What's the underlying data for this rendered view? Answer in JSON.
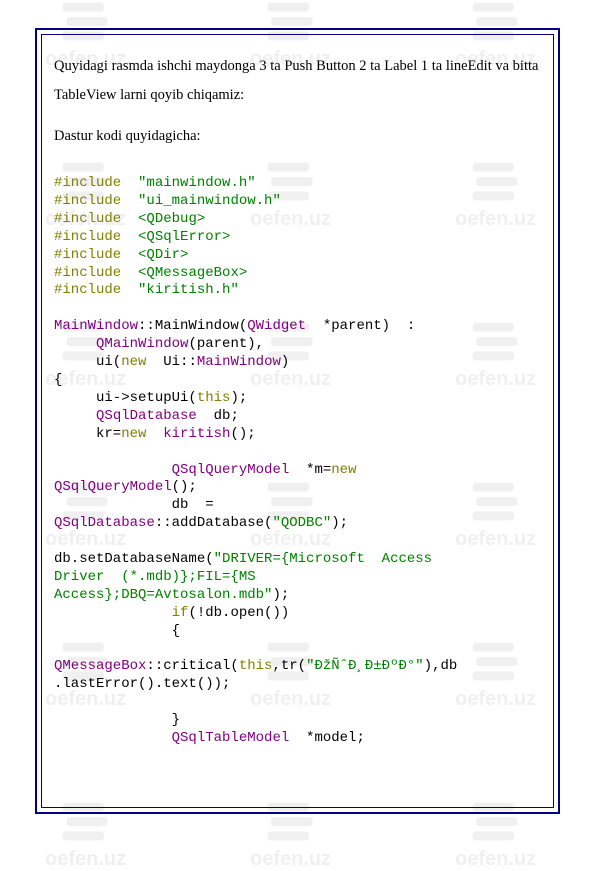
{
  "watermark_text": "oefen.uz",
  "paragraphs": {
    "p1": "Quyidagi rasmda ishchi maydonga 3 ta Push Button 2 ta Label 1 ta lineEdit va bitta TableView larni qoyib chiqamiz:",
    "p2": "Dastur kodi quyidagicha:"
  },
  "code": {
    "tokens": [
      [
        [
          "olive",
          "#include"
        ],
        [
          "black",
          "  "
        ],
        [
          "green",
          "\"mainwindow.h\""
        ]
      ],
      [
        [
          "olive",
          "#include"
        ],
        [
          "black",
          "  "
        ],
        [
          "green",
          "\"ui_mainwindow.h\""
        ]
      ],
      [
        [
          "olive",
          "#include"
        ],
        [
          "black",
          "  "
        ],
        [
          "green",
          "<QDebug>"
        ]
      ],
      [
        [
          "olive",
          "#include"
        ],
        [
          "black",
          "  "
        ],
        [
          "green",
          "<QSqlError>"
        ]
      ],
      [
        [
          "olive",
          "#include"
        ],
        [
          "black",
          "  "
        ],
        [
          "green",
          "<QDir>"
        ]
      ],
      [
        [
          "olive",
          "#include"
        ],
        [
          "black",
          "  "
        ],
        [
          "green",
          "<QMessageBox>"
        ]
      ],
      [
        [
          "olive",
          "#include"
        ],
        [
          "black",
          "  "
        ],
        [
          "green",
          "\"kiritish.h\""
        ]
      ],
      [],
      [
        [
          "purple",
          "MainWindow"
        ],
        [
          "black",
          "::MainWindow("
        ],
        [
          "purple",
          "QWidget"
        ],
        [
          "black",
          "  *parent)  :"
        ]
      ],
      [
        [
          "black",
          "     "
        ],
        [
          "purple",
          "QMainWindow"
        ],
        [
          "black",
          "(parent),"
        ]
      ],
      [
        [
          "black",
          "     ui("
        ],
        [
          "olive",
          "new"
        ],
        [
          "black",
          "  Ui::"
        ],
        [
          "purple",
          "MainWindow"
        ],
        [
          "black",
          ")"
        ]
      ],
      [
        [
          "black",
          "{"
        ]
      ],
      [
        [
          "black",
          "     ui->setupUi("
        ],
        [
          "olive",
          "this"
        ],
        [
          "black",
          ");"
        ]
      ],
      [
        [
          "black",
          "     "
        ],
        [
          "purple",
          "QSqlDatabase"
        ],
        [
          "black",
          "  db;"
        ]
      ],
      [
        [
          "black",
          "     kr="
        ],
        [
          "olive",
          "new"
        ],
        [
          "black",
          "  "
        ],
        [
          "purple",
          "kiritish"
        ],
        [
          "black",
          "();"
        ]
      ],
      [],
      [
        [
          "black",
          "              "
        ],
        [
          "purple",
          "QSqlQueryModel"
        ],
        [
          "black",
          "  *m="
        ],
        [
          "olive",
          "new"
        ]
      ],
      [
        [
          "purple",
          "QSqlQueryModel"
        ],
        [
          "black",
          "();"
        ]
      ],
      [
        [
          "black",
          "              db  ="
        ]
      ],
      [
        [
          "purple",
          "QSqlDatabase"
        ],
        [
          "black",
          "::addDatabase("
        ],
        [
          "green",
          "\"QODBC\""
        ],
        [
          "black",
          ");"
        ]
      ],
      [],
      [
        [
          "black",
          "db.setDatabaseName("
        ],
        [
          "green",
          "\"DRIVER={Microsoft  Access"
        ]
      ],
      [
        [
          "green",
          "Driver  (*.mdb)};FIL={MS"
        ]
      ],
      [
        [
          "green",
          "Access};DBQ=Avtosalon.mdb\""
        ],
        [
          "black",
          ");"
        ]
      ],
      [
        [
          "black",
          "              "
        ],
        [
          "olive",
          "if"
        ],
        [
          "black",
          "(!db.open())"
        ]
      ],
      [
        [
          "black",
          "              {"
        ]
      ],
      [],
      [
        [
          "purple",
          "QMessageBox"
        ],
        [
          "black",
          "::critical("
        ],
        [
          "olive",
          "this"
        ],
        [
          "black",
          ",tr("
        ],
        [
          "green",
          "\"ÐžÑˆÐ¸Ð±ÐºÐ°\""
        ],
        [
          "black",
          "),db"
        ]
      ],
      [
        [
          "black",
          ".lastError().text());"
        ]
      ],
      [],
      [
        [
          "black",
          "              }"
        ]
      ],
      [
        [
          "black",
          "              "
        ],
        [
          "purple",
          "QSqlTableModel"
        ],
        [
          "black",
          "  *model;"
        ]
      ]
    ]
  }
}
